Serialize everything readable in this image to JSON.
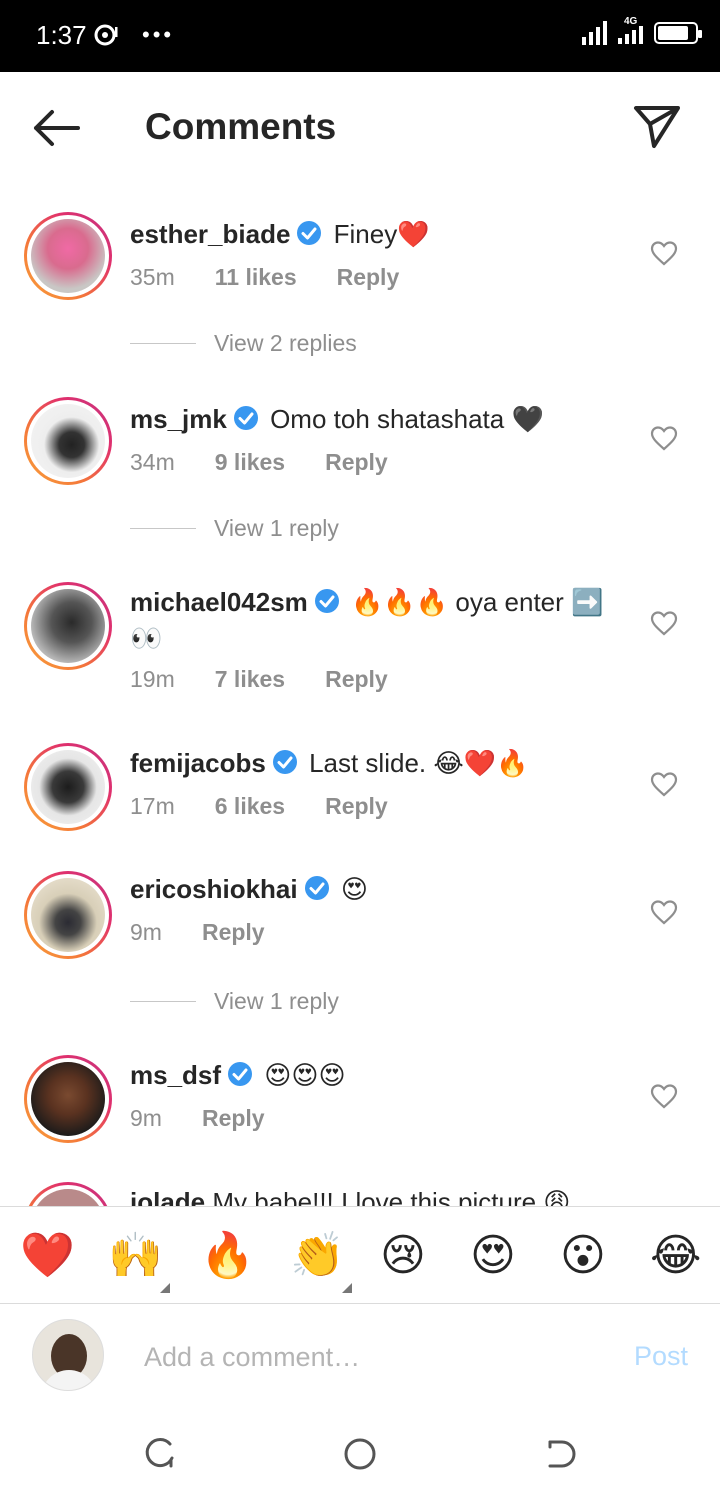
{
  "status_bar": {
    "time": "1:37",
    "network": "4G"
  },
  "header": {
    "title": "Comments",
    "back_icon": "arrow-left-icon",
    "share_icon": "paper-plane-icon"
  },
  "comments": [
    {
      "username": "esther_biade",
      "text": "Finey❤️",
      "time": "35m",
      "likes": "11 likes",
      "reply": "Reply",
      "view_replies": "View 2 replies",
      "avatar_color": "#d9a3b8"
    },
    {
      "username": "ms_jmk",
      "text": "Omo toh shatashata 🖤",
      "time": "34m",
      "likes": "9 likes",
      "reply": "Reply",
      "view_replies": "View 1 reply",
      "avatar_color": "#e9e4e6"
    },
    {
      "username": "michael042sm",
      "text": "🔥🔥🔥 oya enter ➡️👀",
      "time": "19m",
      "likes": "7 likes",
      "reply": "Reply",
      "avatar_color": "#7a7a7a"
    },
    {
      "username": "femijacobs",
      "text": "Last slide. 😂❤️🔥",
      "time": "17m",
      "likes": "6 likes",
      "reply": "Reply",
      "avatar_color": "#dcdcdc"
    },
    {
      "username": "ericoshiokhai",
      "text": "😍",
      "time": "9m",
      "reply": "Reply",
      "view_replies": "View 1 reply",
      "avatar_color": "#c9c0a8"
    },
    {
      "username": "ms_dsf",
      "text": "😍😍😍",
      "time": "9m",
      "reply": "Reply",
      "avatar_color": "#5a3220"
    },
    {
      "username": "iolade",
      "text": "My babe!!! I love this picture 😩",
      "avatar_color": "#b98a8a"
    }
  ],
  "quick_reactions": [
    "❤️",
    "🙌",
    "🔥",
    "👏",
    "😢",
    "😍",
    "😮",
    "😂"
  ],
  "composer": {
    "placeholder": "Add a comment…",
    "post_label": "Post"
  },
  "colors": {
    "accent_blue": "#0095f6",
    "post_disabled": "#b3dbff",
    "verified": "#3897f0",
    "muted": "#8e8e8e"
  }
}
